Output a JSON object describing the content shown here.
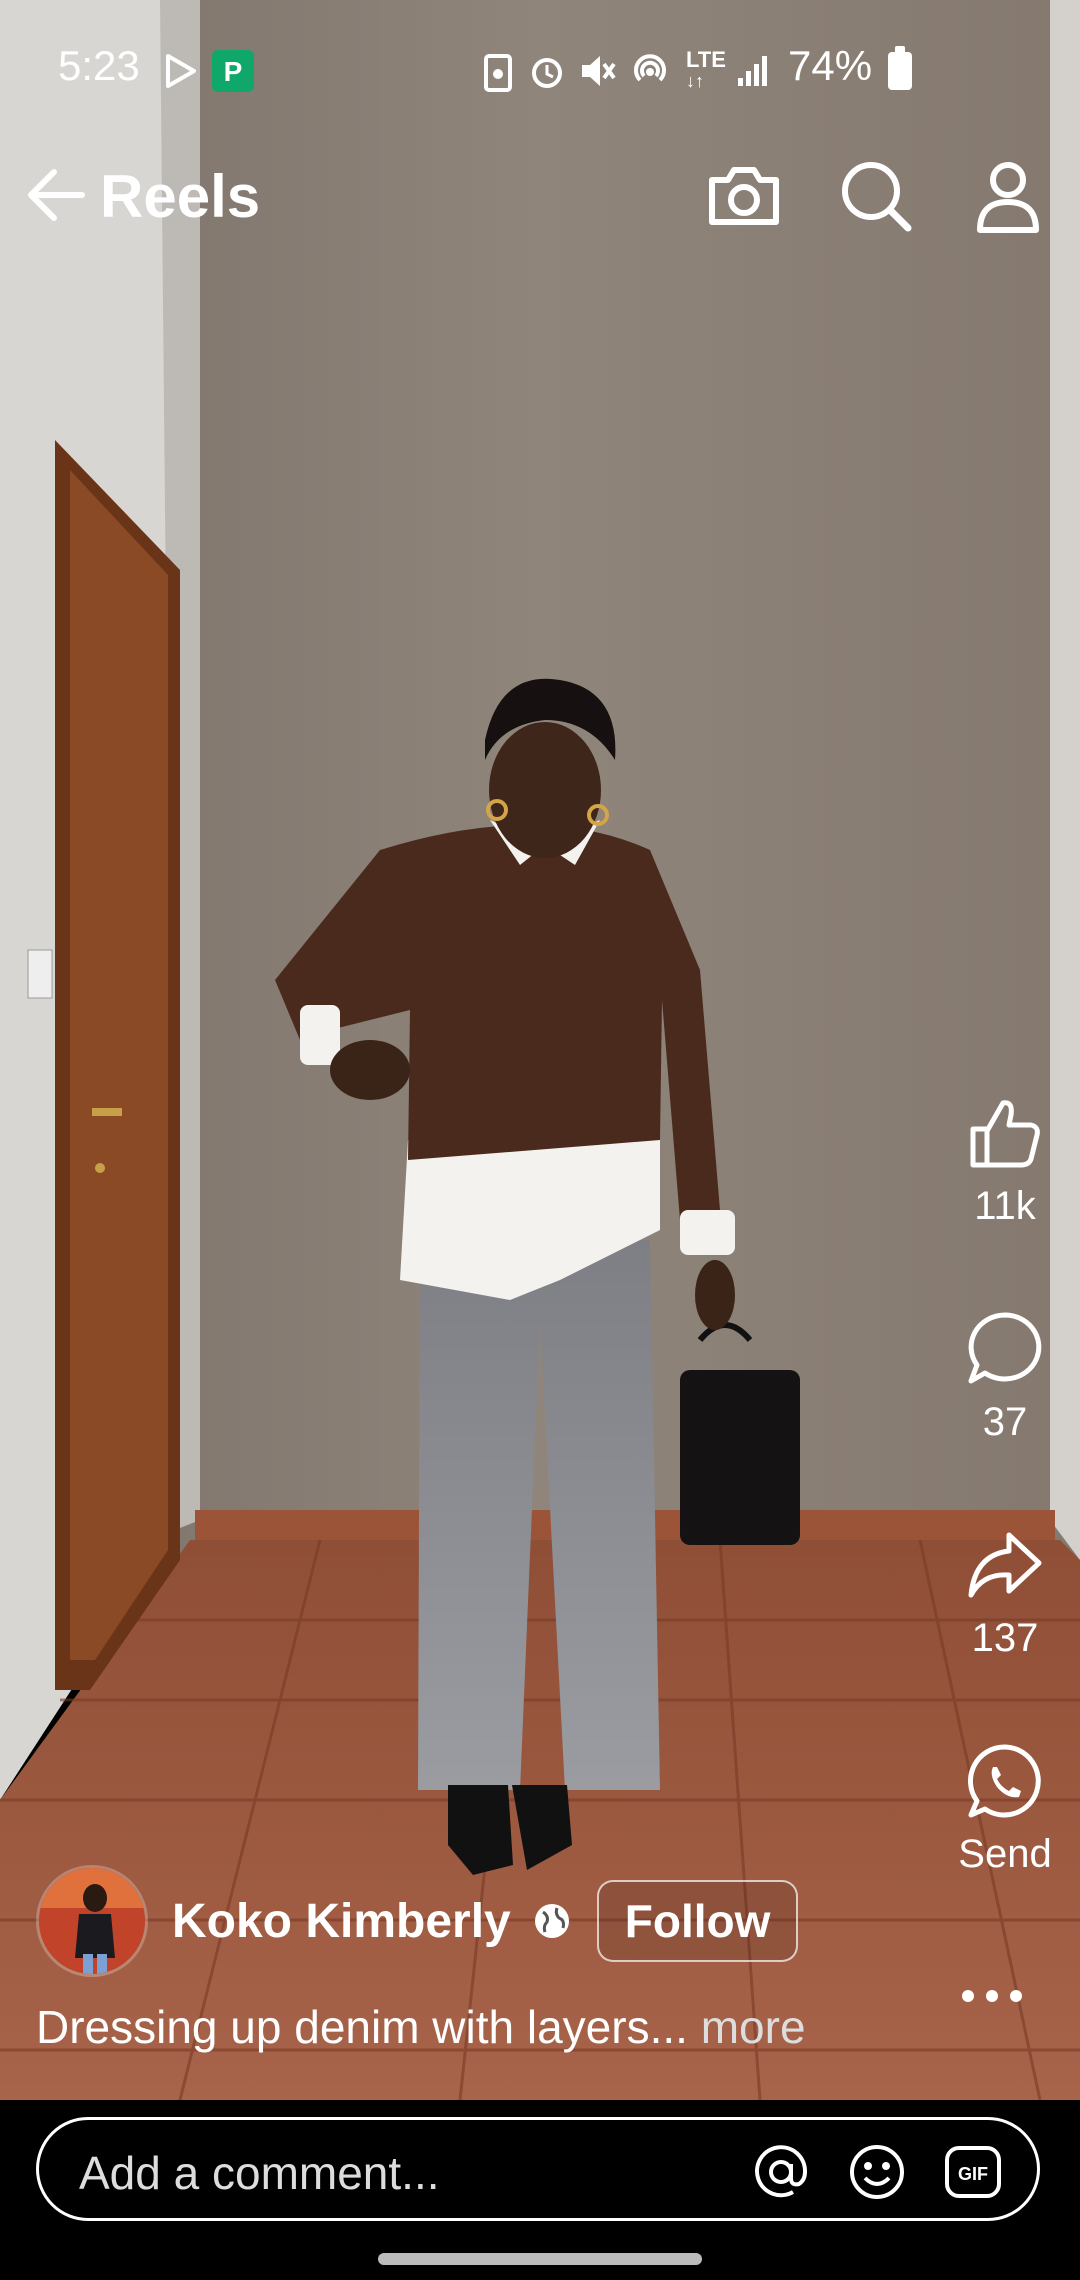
{
  "status_bar": {
    "time": "5:23",
    "network": "LTE",
    "battery_percent": "74%",
    "left_icons": [
      "play-store-icon",
      "paytm-app-icon"
    ],
    "right_icons": [
      "recycle-icon",
      "alarm-icon",
      "mute-icon",
      "hotspot-icon",
      "lte-icon",
      "signal-icon",
      "battery-icon"
    ]
  },
  "header": {
    "title": "Reels",
    "buttons": [
      "back-arrow-icon",
      "camera-icon",
      "search-icon",
      "profile-icon"
    ]
  },
  "actions": {
    "like_count": "11k",
    "comment_count": "37",
    "share_count": "137",
    "send_label": "Send"
  },
  "author": {
    "name": "Koko Kimberly",
    "follow_label": "Follow",
    "visibility_icon": "globe-icon"
  },
  "caption": {
    "text": "Dressing up denim with layers...",
    "more_label": "more"
  },
  "comment_bar": {
    "placeholder": "Add a comment...",
    "icons": [
      "mention-icon",
      "emoji-icon",
      "gif-icon"
    ]
  },
  "colors": {
    "wall": "#8a8076",
    "floor": "#9b5a40",
    "door": "#7a3f1f",
    "sweater": "#4a2a1c",
    "jeans": "#8a8c90"
  }
}
